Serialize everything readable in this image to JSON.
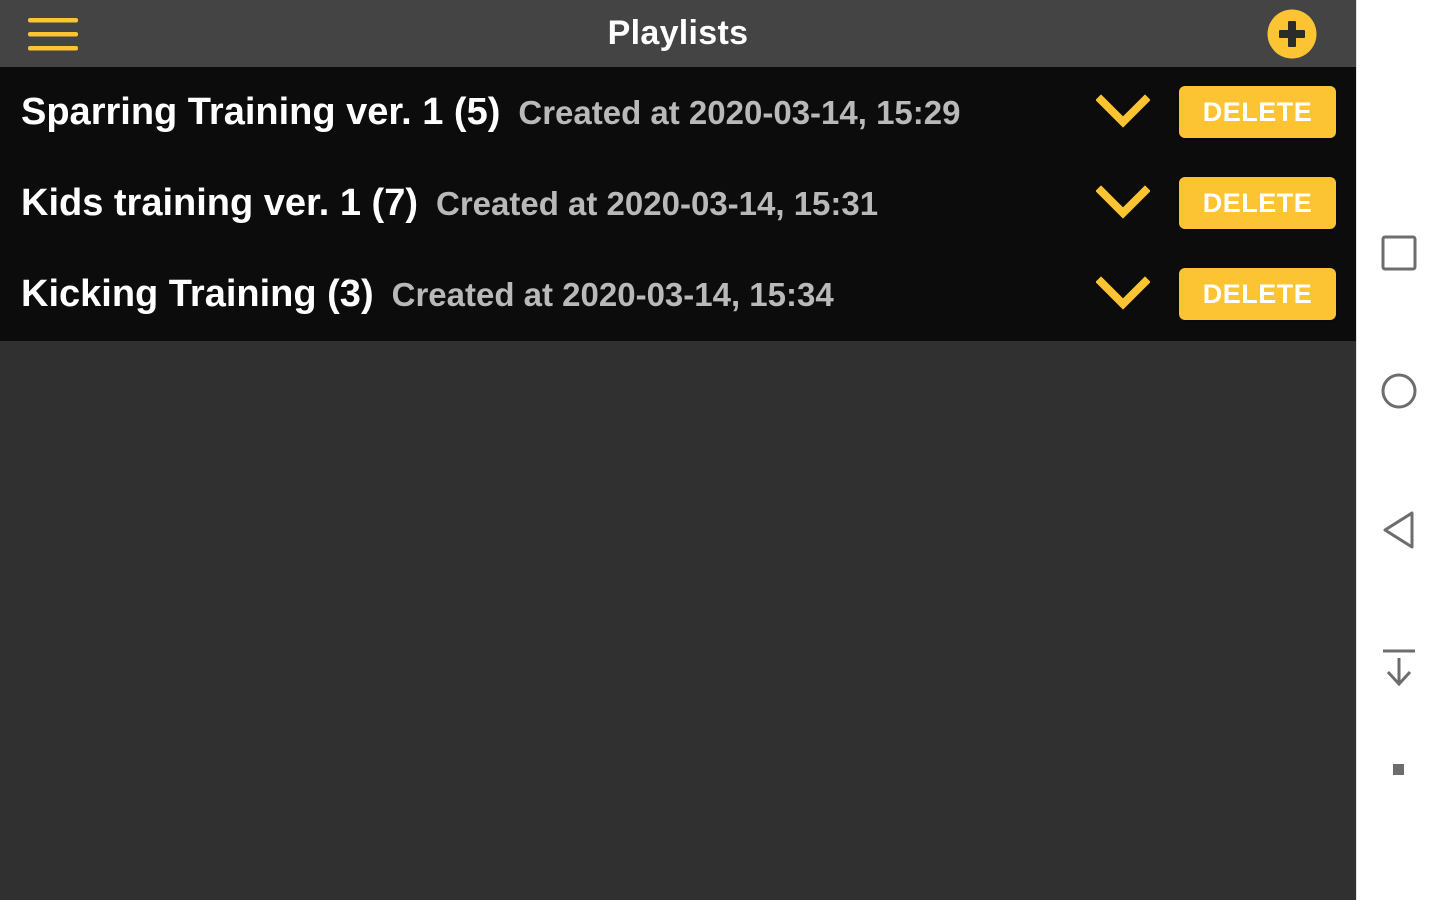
{
  "header": {
    "title": "Playlists",
    "menu_icon": "hamburger-menu-icon",
    "add_icon": "add-circle-icon"
  },
  "playlists": [
    {
      "name": "Sparring Training ver. 1 (5)",
      "created": "Created at 2020-03-14, 15:29",
      "delete_label": "DELETE"
    },
    {
      "name": "Kids training ver. 1 (7)",
      "created": "Created at 2020-03-14, 15:31",
      "delete_label": "DELETE"
    },
    {
      "name": "Kicking Training (3)",
      "created": "Created at 2020-03-14, 15:34",
      "delete_label": "DELETE"
    }
  ],
  "navbar": {
    "icons": [
      "recents-square-icon",
      "home-circle-icon",
      "back-triangle-icon",
      "pull-down-arrow-icon",
      "small-square-icon"
    ]
  },
  "colors": {
    "accent": "#fcc432",
    "header_bg": "#444444",
    "list_bg": "#0c0c0c",
    "body_bg": "#303030",
    "secondary_text": "#b9b9b9"
  }
}
